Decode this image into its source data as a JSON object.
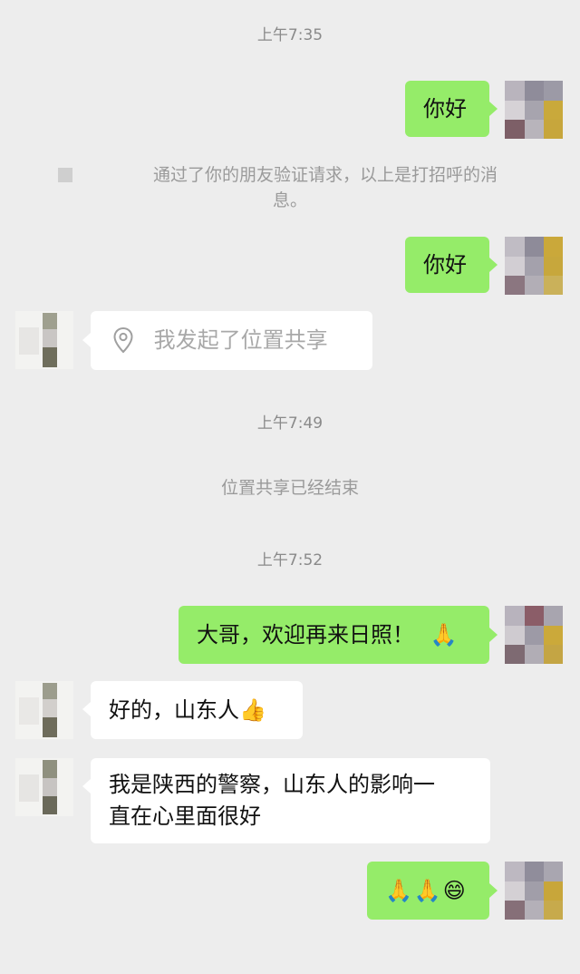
{
  "timestamps": [
    "上午7:35",
    "上午7:49",
    "上午7:52"
  ],
  "system": {
    "friend_verification_line1": "通过了你的朋友验证请求，以上是打招呼的消",
    "friend_verification_line2": "息。",
    "location_share_ended": "位置共享已经结束"
  },
  "messages": {
    "m1": "你好",
    "m2": "你好",
    "m3_location": "我发起了位置共享",
    "m4": "大哥，欢迎再来日照！",
    "m4_emoji": "🙏",
    "m5": "好的，山东人",
    "m5_emoji": "👍",
    "m6_line1": "我是陕西的警察，山东人的影响一",
    "m6_line2": "直在心里面很好",
    "m7_emoji": "🙏🙏😄"
  },
  "colors": {
    "background": "#ededed",
    "sent_bubble": "#95ec69",
    "received_bubble": "#ffffff",
    "meta_text": "#8a8a8a"
  }
}
